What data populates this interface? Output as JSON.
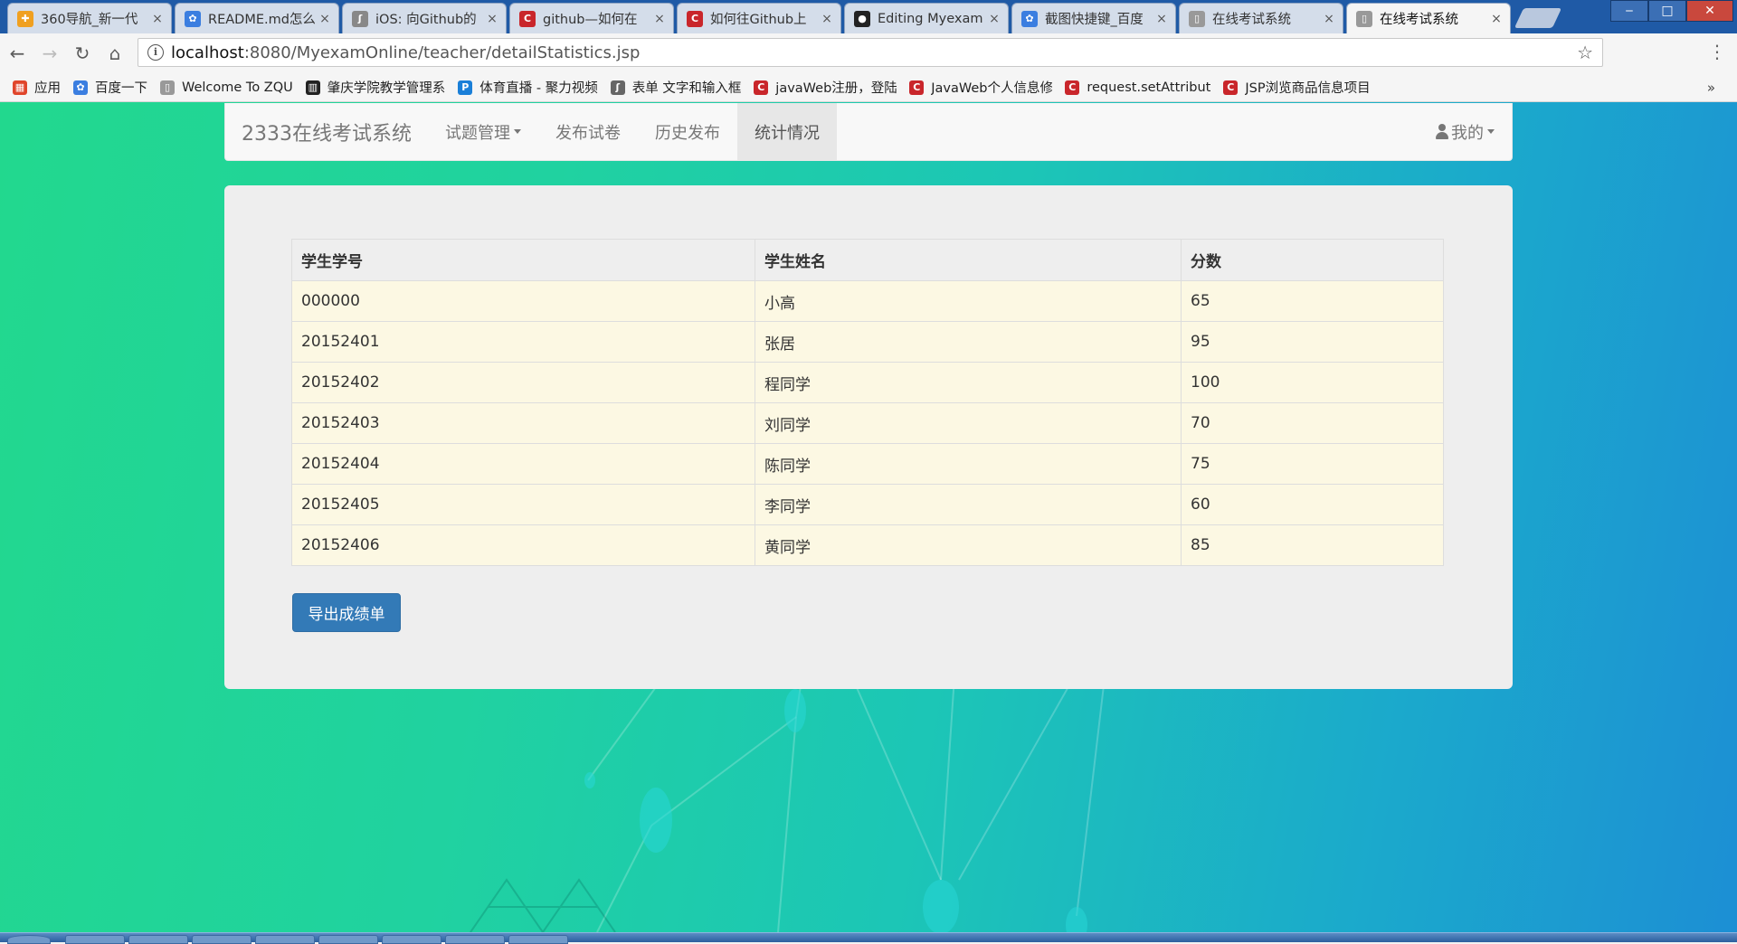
{
  "browser": {
    "tabs": [
      {
        "title": "360导航_新一代",
        "icon": "360-icon",
        "color": "#f0a020",
        "glyph": "✚"
      },
      {
        "title": "README.md怎么",
        "icon": "baidu-paw-icon",
        "color": "#3b7ee0",
        "glyph": "✿"
      },
      {
        "title": "iOS: 向Github的",
        "icon": "curl-icon",
        "color": "#888888",
        "glyph": "ʃ"
      },
      {
        "title": "github—如何在",
        "icon": "csdn-icon",
        "color": "#c9262b",
        "glyph": "C"
      },
      {
        "title": "如何往Github上",
        "icon": "csdn-icon",
        "color": "#c9262b",
        "glyph": "C"
      },
      {
        "title": "Editing Myexam",
        "icon": "github-icon",
        "color": "#222222",
        "glyph": "●"
      },
      {
        "title": "截图快捷键_百度",
        "icon": "baidu-paw-icon",
        "color": "#3b7ee0",
        "glyph": "✿"
      },
      {
        "title": "在线考试系统",
        "icon": "page-icon",
        "color": "#999999",
        "glyph": "▯"
      },
      {
        "title": "在线考试系统",
        "icon": "page-icon",
        "color": "#999999",
        "glyph": "▯"
      }
    ],
    "url_host": "localhost",
    "url_path": ":8080/MyexamOnline/teacher/detailStatistics.jsp",
    "bookmarks": [
      {
        "label": "应用",
        "icon": "apps-grid-icon",
        "color": "#e0452b",
        "glyph": "▦"
      },
      {
        "label": "百度一下",
        "icon": "baidu-paw-icon",
        "color": "#3b7ee0",
        "glyph": "✿"
      },
      {
        "label": "Welcome To ZQU",
        "icon": "page-icon",
        "color": "#999999",
        "glyph": "▯"
      },
      {
        "label": "肇庆学院教学管理系",
        "icon": "building-icon",
        "color": "#222222",
        "glyph": "▥"
      },
      {
        "label": "体育直播 - 聚力视频",
        "icon": "pptv-icon",
        "color": "#1a7fd8",
        "glyph": "P"
      },
      {
        "label": "表单 文字和输入框",
        "icon": "curl-icon",
        "color": "#666666",
        "glyph": "ʃ"
      },
      {
        "label": "javaWeb注册，登陆",
        "icon": "csdn-icon",
        "color": "#c9262b",
        "glyph": "C"
      },
      {
        "label": "JavaWeb个人信息修",
        "icon": "csdn-icon",
        "color": "#c9262b",
        "glyph": "C"
      },
      {
        "label": "request.setAttribut",
        "icon": "csdn-icon",
        "color": "#c9262b",
        "glyph": "C"
      },
      {
        "label": "JSP浏览商品信息项目",
        "icon": "csdn-icon",
        "color": "#c9262b",
        "glyph": "C"
      }
    ],
    "more_bookmarks": "»"
  },
  "navbar": {
    "brand": "2333在线考试系统",
    "items": [
      {
        "label": "试题管理",
        "dropdown": true
      },
      {
        "label": "发布试卷"
      },
      {
        "label": "历史发布"
      },
      {
        "label": "统计情况",
        "active": true
      }
    ],
    "user_menu": "我的"
  },
  "table": {
    "headers": [
      "学生学号",
      "学生姓名",
      "分数"
    ],
    "rows": [
      [
        "000000",
        "小高",
        "65"
      ],
      [
        "20152401",
        "张居",
        "95"
      ],
      [
        "20152402",
        "程同学",
        "100"
      ],
      [
        "20152403",
        "刘同学",
        "70"
      ],
      [
        "20152404",
        "陈同学",
        "75"
      ],
      [
        "20152405",
        "李同学",
        "60"
      ],
      [
        "20152406",
        "黄同学",
        "85"
      ]
    ]
  },
  "export_button": "导出成绩单",
  "colors": {
    "primary_button": "#337ab7",
    "row_highlight": "#fcf8e3",
    "background_start": "#22d88e",
    "background_end": "#1c8fd4"
  }
}
